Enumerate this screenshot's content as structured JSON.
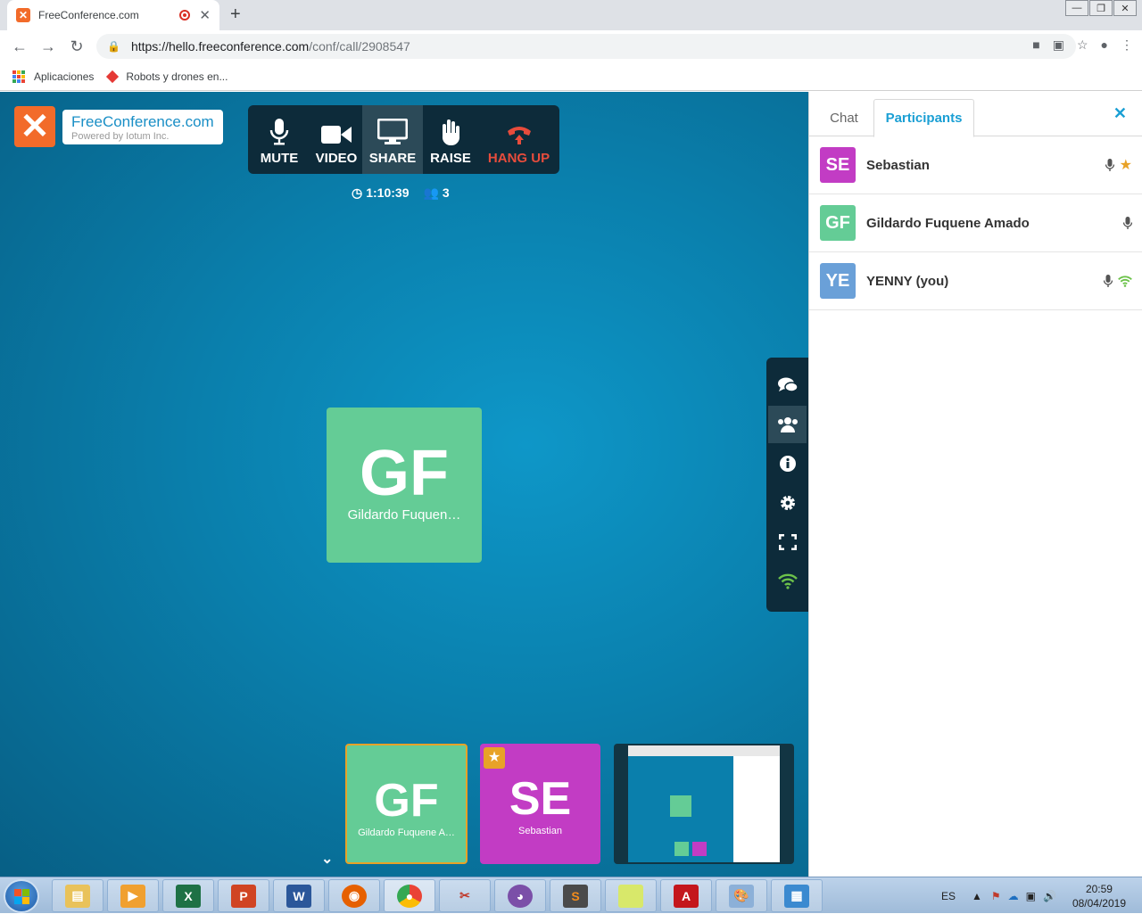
{
  "browser": {
    "tab_title": "FreeConference.com",
    "url_host": "https://hello.freeconference.com",
    "url_path": "/conf/call/2908547",
    "bookmarks": [
      "Aplicaciones",
      "Robots y drones en..."
    ]
  },
  "brand": {
    "name": "FreeConference.com",
    "powered_by": "Powered by Iotum Inc.",
    "accent": "#f26b2a"
  },
  "controls": {
    "mute": "MUTE",
    "video": "VIDEO",
    "share": "SHARE",
    "raise": "RAISE",
    "hangup": "HANG UP"
  },
  "stats": {
    "duration": "1:10:39",
    "participant_count": "3"
  },
  "main_tile": {
    "initials": "GF",
    "name": "Gildardo Fuquen…",
    "color": "#64cc96"
  },
  "thumbnails": [
    {
      "initials": "GF",
      "name": "Gildardo Fuquene A…",
      "color": "#64cc96"
    },
    {
      "initials": "SE",
      "name": "Sebastian",
      "color": "#c23cc4",
      "starred": true
    }
  ],
  "side_rail": [
    "chat-icon",
    "participants-icon",
    "info-icon",
    "settings-icon",
    "fullscreen-icon",
    "wifi-icon"
  ],
  "panel": {
    "tabs": [
      "Chat",
      "Participants"
    ],
    "active_tab": "Participants",
    "participants": [
      {
        "initials": "SE",
        "name": "Sebastian",
        "color": "#c23cc4",
        "icons": [
          "mic-icon",
          "star-icon"
        ]
      },
      {
        "initials": "GF",
        "name": "Gildardo Fuquene Amado",
        "color": "#64cc96",
        "icons": [
          "mic-icon"
        ]
      },
      {
        "initials": "YE",
        "name": "YENNY (you)",
        "color": "#6aa0d8",
        "icons": [
          "mic-icon",
          "wifi-icon"
        ]
      }
    ]
  },
  "taskbar": {
    "language": "ES",
    "time": "20:59",
    "date": "08/04/2019"
  }
}
